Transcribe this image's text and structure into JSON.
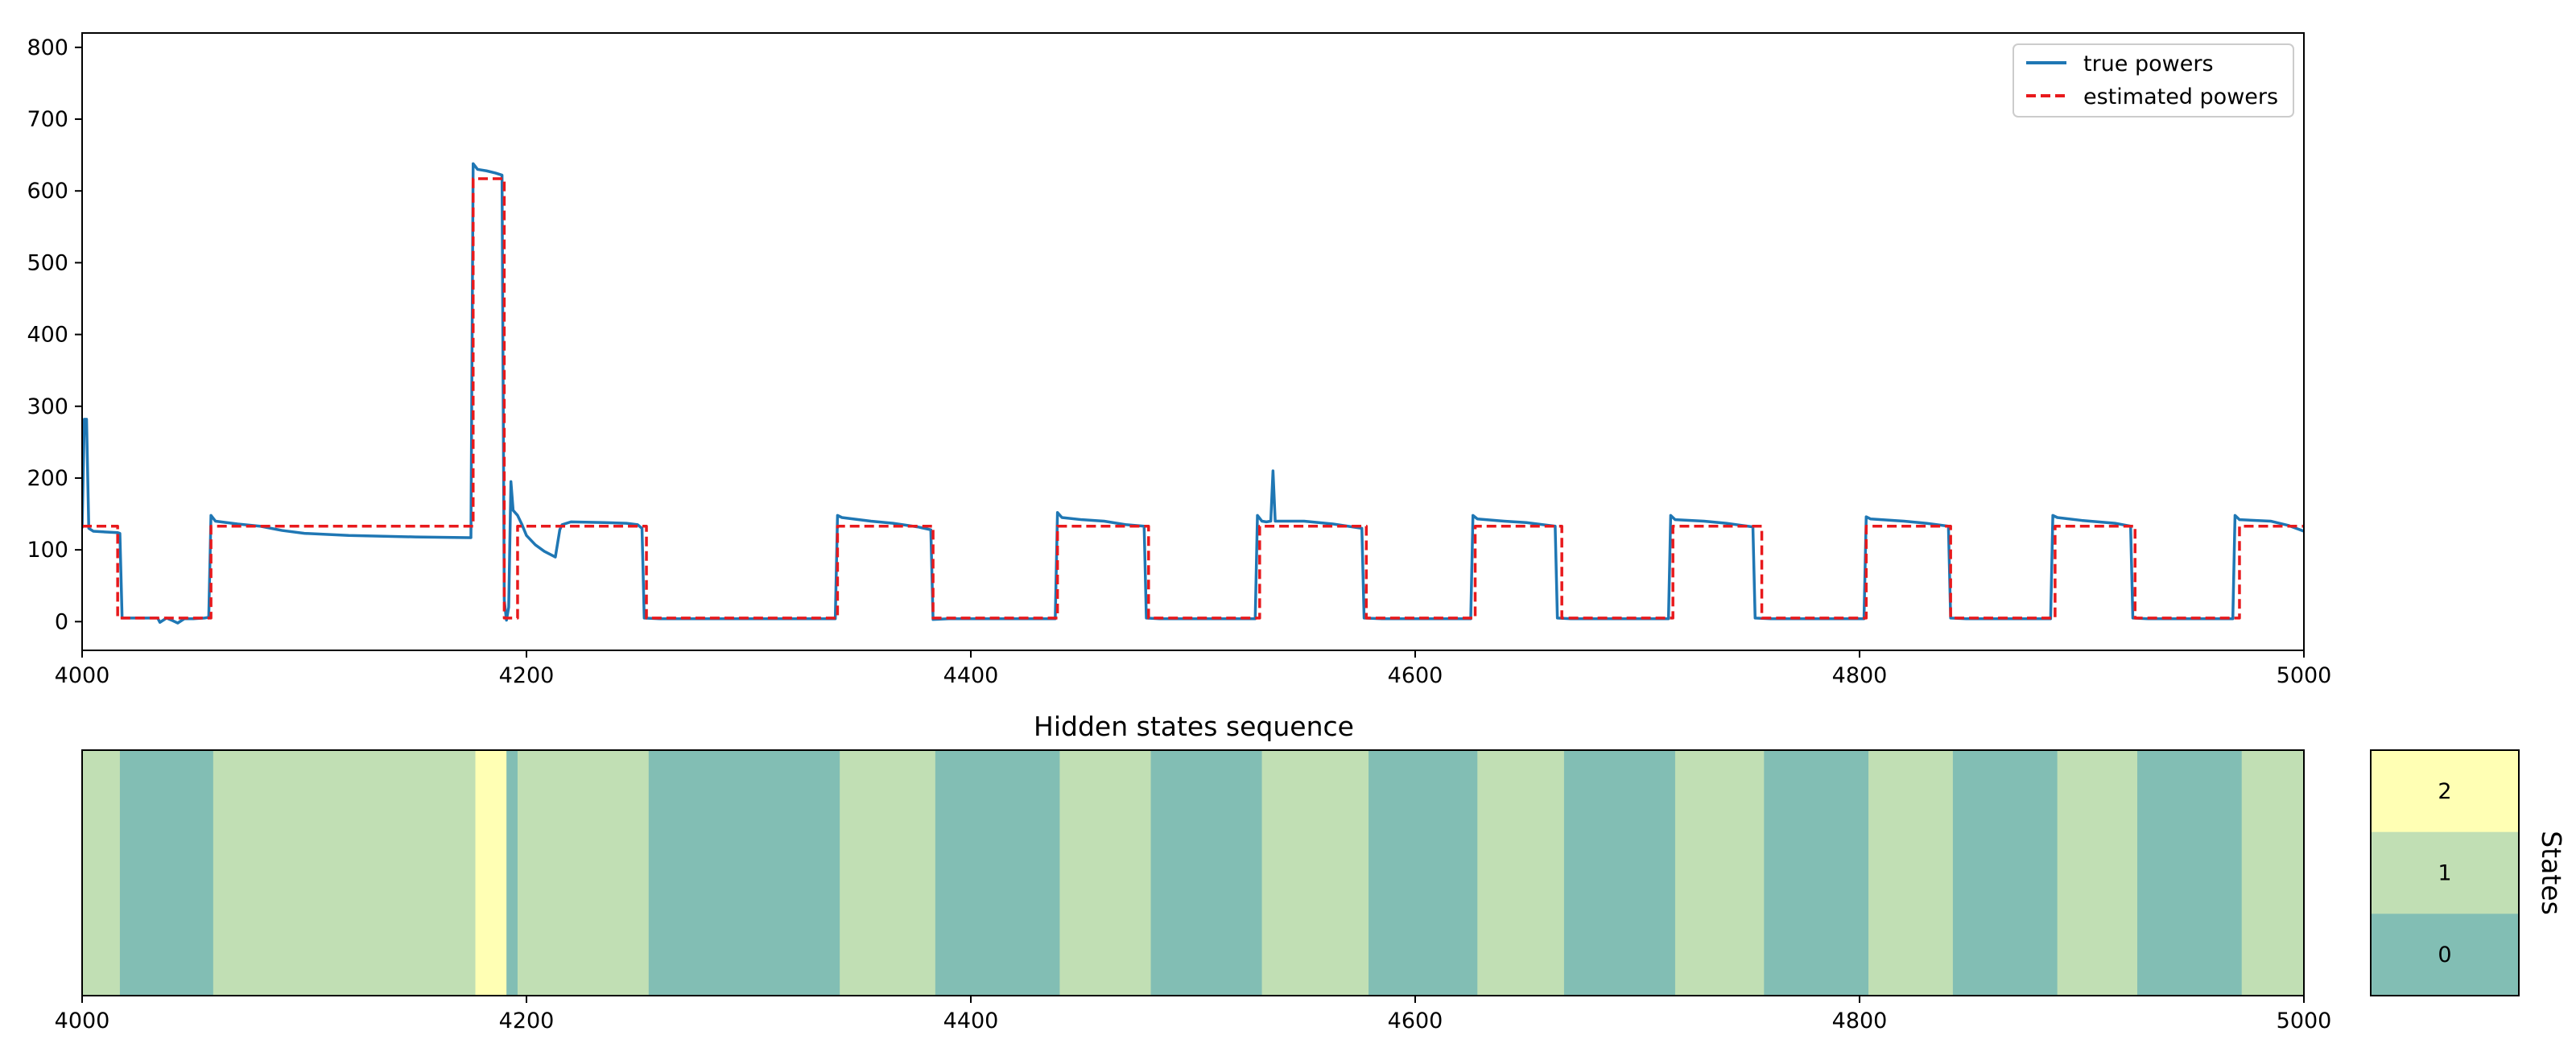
{
  "chart_data": [
    {
      "type": "line",
      "title": "",
      "xlabel": "",
      "ylabel": "",
      "xlim": [
        4000,
        5000
      ],
      "ylim": [
        -40,
        820
      ],
      "xticks": [
        "4000",
        "4200",
        "4400",
        "4600",
        "4800",
        "5000"
      ],
      "yticks": [
        "0",
        "100",
        "200",
        "300",
        "400",
        "500",
        "600",
        "700",
        "800"
      ],
      "legend": {
        "position": "top-right"
      },
      "series": [
        {
          "name": "true powers",
          "color": "#1f77b4",
          "style": "solid",
          "points": [
            [
              4000,
              130
            ],
            [
              4001,
              282
            ],
            [
              4002,
              282
            ],
            [
              4003,
              130
            ],
            [
              4005,
              126
            ],
            [
              4010,
              125
            ],
            [
              4016,
              124
            ],
            [
              4017,
              123
            ],
            [
              4018,
              5
            ],
            [
              4025,
              5
            ],
            [
              4034,
              5
            ],
            [
              4035,
              -1
            ],
            [
              4038,
              5
            ],
            [
              4041,
              1
            ],
            [
              4043,
              -2
            ],
            [
              4046,
              4
            ],
            [
              4050,
              4
            ],
            [
              4055,
              5
            ],
            [
              4057,
              6
            ],
            [
              4058,
              148
            ],
            [
              4060,
              140
            ],
            [
              4070,
              136
            ],
            [
              4080,
              133
            ],
            [
              4085,
              130
            ],
            [
              4090,
              127
            ],
            [
              4100,
              123
            ],
            [
              4120,
              120
            ],
            [
              4150,
              118
            ],
            [
              4174,
              117
            ],
            [
              4175,
              117
            ],
            [
              4176,
              638
            ],
            [
              4178,
              630
            ],
            [
              4182,
              628
            ],
            [
              4186,
              625
            ],
            [
              4189,
              622
            ],
            [
              4190,
              30
            ],
            [
              4191,
              2
            ],
            [
              4192,
              20
            ],
            [
              4193,
              195
            ],
            [
              4194,
              155
            ],
            [
              4196,
              148
            ],
            [
              4198,
              135
            ],
            [
              4200,
              120
            ],
            [
              4204,
              107
            ],
            [
              4208,
              98
            ],
            [
              4213,
              90
            ],
            [
              4215,
              128
            ],
            [
              4216,
              135
            ],
            [
              4220,
              139
            ],
            [
              4235,
              138
            ],
            [
              4245,
              137
            ],
            [
              4250,
              135
            ],
            [
              4252,
              130
            ],
            [
              4253,
              5
            ],
            [
              4260,
              4
            ],
            [
              4339,
              4
            ],
            [
              4340,
              148
            ],
            [
              4342,
              145
            ],
            [
              4355,
              140
            ],
            [
              4365,
              137
            ],
            [
              4376,
              132
            ],
            [
              4382,
              128
            ],
            [
              4383,
              3
            ],
            [
              4390,
              4
            ],
            [
              4438,
              4
            ],
            [
              4439,
              152
            ],
            [
              4441,
              145
            ],
            [
              4450,
              142
            ],
            [
              4460,
              140
            ],
            [
              4470,
              135
            ],
            [
              4478,
              133
            ],
            [
              4479,
              5
            ],
            [
              4485,
              4
            ],
            [
              4528,
              4
            ],
            [
              4529,
              148
            ],
            [
              4531,
              140
            ],
            [
              4533,
              139
            ],
            [
              4535,
              140
            ],
            [
              4536,
              210
            ],
            [
              4537,
              140
            ],
            [
              4550,
              140
            ],
            [
              4563,
              136
            ],
            [
              4576,
              130
            ],
            [
              4577,
              5
            ],
            [
              4585,
              4
            ],
            [
              4625,
              4
            ],
            [
              4626,
              148
            ],
            [
              4628,
              143
            ],
            [
              4640,
              140
            ],
            [
              4650,
              138
            ],
            [
              4663,
              133
            ],
            [
              4664,
              5
            ],
            [
              4670,
              4
            ],
            [
              4714,
              4
            ],
            [
              4715,
              148
            ],
            [
              4717,
              142
            ],
            [
              4730,
              140
            ],
            [
              4740,
              137
            ],
            [
              4752,
              132
            ],
            [
              4753,
              5
            ],
            [
              4760,
              4
            ],
            [
              4802,
              4
            ],
            [
              4803,
              146
            ],
            [
              4805,
              143
            ],
            [
              4820,
              140
            ],
            [
              4830,
              137
            ],
            [
              4840,
              133
            ],
            [
              4841,
              5
            ],
            [
              4848,
              4
            ],
            [
              4886,
              4
            ],
            [
              4887,
              148
            ],
            [
              4889,
              145
            ],
            [
              4900,
              141
            ],
            [
              4915,
              137
            ],
            [
              4922,
              133
            ],
            [
              4923,
              5
            ],
            [
              4930,
              4
            ],
            [
              4968,
              4
            ],
            [
              4969,
              148
            ],
            [
              4971,
              142
            ],
            [
              4985,
              140
            ],
            [
              4993,
              134
            ],
            [
              5000,
              126
            ]
          ]
        },
        {
          "name": "estimated powers",
          "color": "#e8191c",
          "style": "dashed",
          "points": [
            [
              4000,
              133
            ],
            [
              4016,
              133
            ],
            [
              4016,
              5
            ],
            [
              4058,
              5
            ],
            [
              4058,
              133
            ],
            [
              4176,
              133
            ],
            [
              4176,
              617
            ],
            [
              4190,
              617
            ],
            [
              4190,
              5
            ],
            [
              4196,
              5
            ],
            [
              4196,
              133
            ],
            [
              4254,
              133
            ],
            [
              4254,
              5
            ],
            [
              4340,
              5
            ],
            [
              4340,
              133
            ],
            [
              4383,
              133
            ],
            [
              4383,
              5
            ],
            [
              4439,
              5
            ],
            [
              4439,
              133
            ],
            [
              4480,
              133
            ],
            [
              4480,
              5
            ],
            [
              4530,
              5
            ],
            [
              4530,
              133
            ],
            [
              4578,
              133
            ],
            [
              4578,
              5
            ],
            [
              4627,
              5
            ],
            [
              4627,
              133
            ],
            [
              4666,
              133
            ],
            [
              4666,
              5
            ],
            [
              4716,
              5
            ],
            [
              4716,
              133
            ],
            [
              4756,
              133
            ],
            [
              4756,
              5
            ],
            [
              4803,
              5
            ],
            [
              4803,
              133
            ],
            [
              4841,
              133
            ],
            [
              4841,
              5
            ],
            [
              4888,
              5
            ],
            [
              4888,
              133
            ],
            [
              4924,
              133
            ],
            [
              4924,
              5
            ],
            [
              4971,
              5
            ],
            [
              4971,
              133
            ],
            [
              5000,
              133
            ]
          ]
        }
      ]
    },
    {
      "type": "heatmap",
      "title": "Hidden states sequence",
      "xlim": [
        4000,
        5000
      ],
      "xticks": [
        "4000",
        "4200",
        "4400",
        "4600",
        "4800",
        "5000"
      ],
      "state_colors": {
        "0": "#82beb4",
        "1": "#c1dfb4",
        "2": "#ffffb4"
      },
      "segments": [
        {
          "start": 4000,
          "end": 4017,
          "state": 1
        },
        {
          "start": 4017,
          "end": 4059,
          "state": 0
        },
        {
          "start": 4059,
          "end": 4177,
          "state": 1
        },
        {
          "start": 4177,
          "end": 4191,
          "state": 2
        },
        {
          "start": 4191,
          "end": 4196,
          "state": 0
        },
        {
          "start": 4196,
          "end": 4255,
          "state": 1
        },
        {
          "start": 4255,
          "end": 4341,
          "state": 0
        },
        {
          "start": 4341,
          "end": 4384,
          "state": 1
        },
        {
          "start": 4384,
          "end": 4440,
          "state": 0
        },
        {
          "start": 4440,
          "end": 4481,
          "state": 1
        },
        {
          "start": 4481,
          "end": 4531,
          "state": 0
        },
        {
          "start": 4531,
          "end": 4579,
          "state": 1
        },
        {
          "start": 4579,
          "end": 4628,
          "state": 0
        },
        {
          "start": 4628,
          "end": 4667,
          "state": 1
        },
        {
          "start": 4667,
          "end": 4717,
          "state": 0
        },
        {
          "start": 4717,
          "end": 4757,
          "state": 1
        },
        {
          "start": 4757,
          "end": 4804,
          "state": 0
        },
        {
          "start": 4804,
          "end": 4842,
          "state": 1
        },
        {
          "start": 4842,
          "end": 4889,
          "state": 0
        },
        {
          "start": 4889,
          "end": 4925,
          "state": 1
        },
        {
          "start": 4925,
          "end": 4972,
          "state": 0
        },
        {
          "start": 4972,
          "end": 5000,
          "state": 1
        }
      ]
    },
    {
      "type": "colorbar",
      "label": "States",
      "levels": [
        "2",
        "1",
        "0"
      ]
    }
  ]
}
